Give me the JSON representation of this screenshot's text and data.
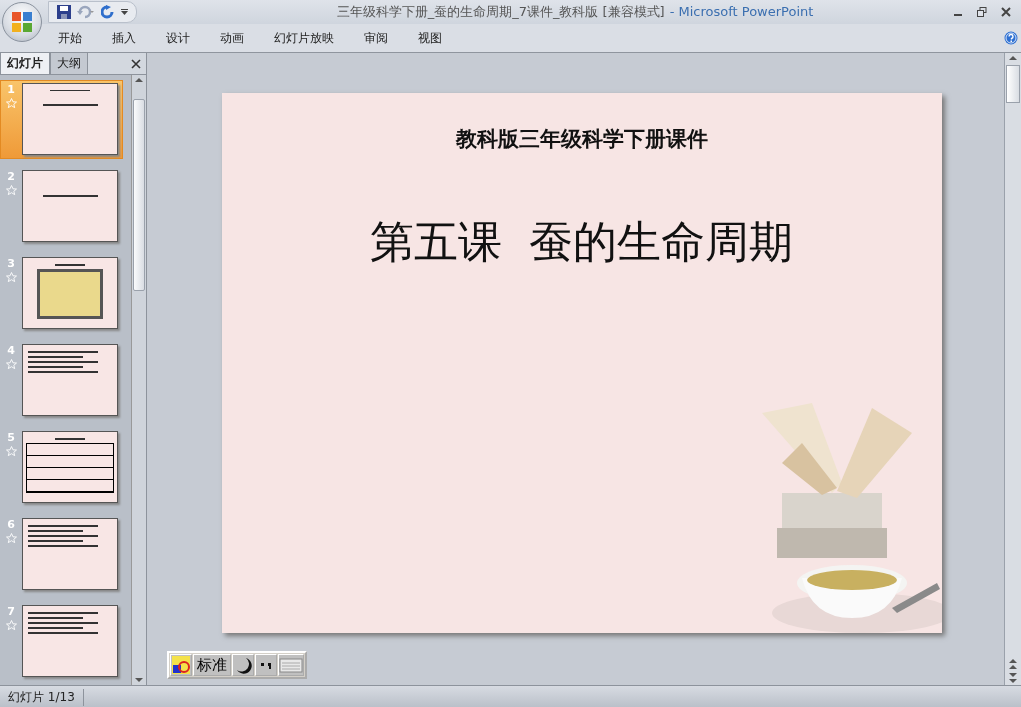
{
  "window": {
    "document_title": "三年级科学下册_蚕的生命周期_7课件_教科版 [兼容模式]",
    "app_name": "- Microsoft PowerPoint"
  },
  "ribbon_tabs": [
    {
      "label": "开始"
    },
    {
      "label": "插入"
    },
    {
      "label": "设计"
    },
    {
      "label": "动画"
    },
    {
      "label": "幻灯片放映"
    },
    {
      "label": "审阅"
    },
    {
      "label": "视图"
    }
  ],
  "panel_tabs": [
    {
      "label": "幻灯片",
      "selected": true
    },
    {
      "label": "大纲",
      "selected": false
    }
  ],
  "thumbnails": [
    {
      "number": "1",
      "selected": true,
      "kind": "title"
    },
    {
      "number": "2",
      "selected": false,
      "kind": "line"
    },
    {
      "number": "3",
      "selected": false,
      "kind": "photos"
    },
    {
      "number": "4",
      "selected": false,
      "kind": "text"
    },
    {
      "number": "5",
      "selected": false,
      "kind": "table"
    },
    {
      "number": "6",
      "selected": false,
      "kind": "text"
    },
    {
      "number": "7",
      "selected": false,
      "kind": "text"
    }
  ],
  "slide": {
    "subtitle": "教科版三年级科学下册课件",
    "title": "第五课  蚕的生命周期"
  },
  "ime_toolbar": {
    "mode": "标准"
  },
  "status_bar": {
    "slide_counter": "幻灯片 1/13"
  }
}
